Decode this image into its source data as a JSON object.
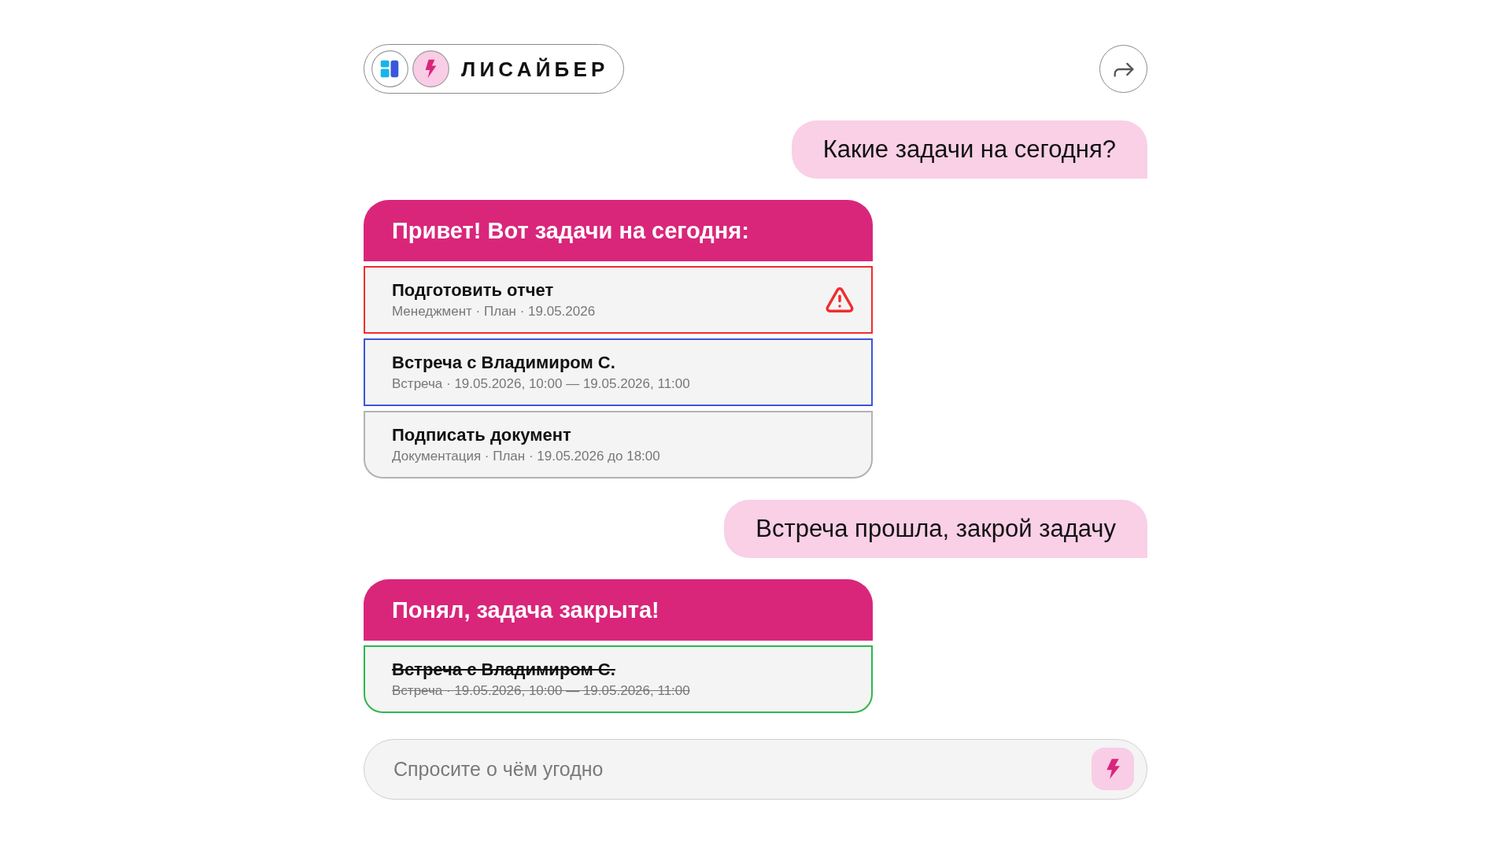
{
  "header": {
    "brand": "ЛИСАЙБЕР"
  },
  "messages": [
    {
      "kind": "user",
      "text": "Какие задачи на сегодня?"
    },
    {
      "kind": "bot",
      "title": "Привет! Вот задачи на сегодня:",
      "tasks": [
        {
          "title": "Подготовить отчет",
          "meta": "Менеджмент · План · 19.05.2026",
          "color": "#f02d2d",
          "warning": true,
          "done": false
        },
        {
          "title": "Встреча с Владимиром С.",
          "meta": "Встреча · 19.05.2026, 10:00 — 19.05.2026, 11:00",
          "color": "#3b56d9",
          "warning": false,
          "done": false
        },
        {
          "title": "Подписать документ",
          "meta": "Документация · План · 19.05.2026 до 18:00",
          "color": "#b3b3b3",
          "warning": false,
          "done": false
        }
      ]
    },
    {
      "kind": "user",
      "text": "Встреча прошла, закрой задачу"
    },
    {
      "kind": "bot",
      "title": "Понял, задача закрыта!",
      "tasks": [
        {
          "title": "Встреча с Владимиром С.",
          "meta": "Встреча · 19.05.2026, 10:00 — 19.05.2026, 11:00",
          "color": "#2cb84e",
          "warning": false,
          "done": true
        }
      ]
    }
  ],
  "composer": {
    "placeholder": "Спросите о чём угодно"
  }
}
